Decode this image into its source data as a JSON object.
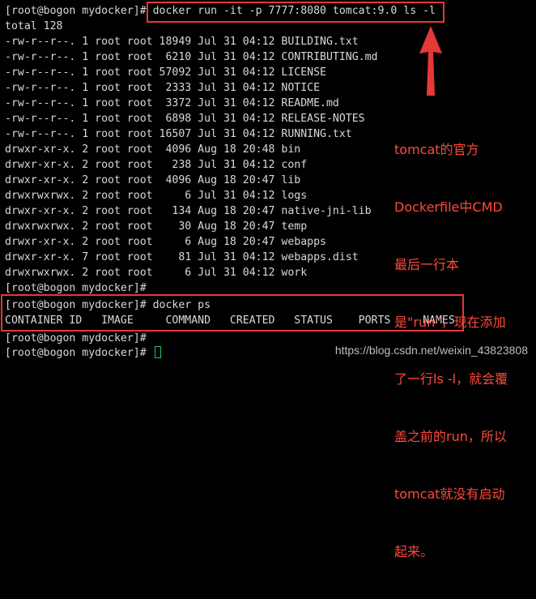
{
  "terminal": {
    "lines": [
      "[root@bogon mydocker]# docker run -it -p 7777:8080 tomcat:9.0 ls -l",
      "total 128",
      "-rw-r--r--. 1 root root 18949 Jul 31 04:12 BUILDING.txt",
      "-rw-r--r--. 1 root root  6210 Jul 31 04:12 CONTRIBUTING.md",
      "-rw-r--r--. 1 root root 57092 Jul 31 04:12 LICENSE",
      "-rw-r--r--. 1 root root  2333 Jul 31 04:12 NOTICE",
      "-rw-r--r--. 1 root root  3372 Jul 31 04:12 README.md",
      "-rw-r--r--. 1 root root  6898 Jul 31 04:12 RELEASE-NOTES",
      "-rw-r--r--. 1 root root 16507 Jul 31 04:12 RUNNING.txt",
      "drwxr-xr-x. 2 root root  4096 Aug 18 20:48 bin",
      "drwxr-xr-x. 2 root root   238 Jul 31 04:12 conf",
      "drwxr-xr-x. 2 root root  4096 Aug 18 20:47 lib",
      "drwxrwxrwx. 2 root root     6 Jul 31 04:12 logs",
      "drwxr-xr-x. 2 root root   134 Aug 18 20:47 native-jni-lib",
      "drwxrwxrwx. 2 root root    30 Aug 18 20:47 temp",
      "drwxr-xr-x. 2 root root     6 Aug 18 20:47 webapps",
      "drwxr-xr-x. 7 root root    81 Jul 31 04:12 webapps.dist",
      "drwxrwxrwx. 2 root root     6 Jul 31 04:12 work",
      "[root@bogon mydocker]#",
      "[root@bogon mydocker]# docker ps",
      "CONTAINER ID   IMAGE     COMMAND   CREATED   STATUS    PORTS     NAMES",
      "[root@bogon mydocker]#",
      "[root@bogon mydocker]# "
    ]
  },
  "annotation": {
    "lines": [
      "tomcat的官方",
      "Dockerfile中CMD",
      "最后一行本",
      "是\"run\"，现在添加",
      "了一行ls -l，就会覆",
      "盖之前的run，所以",
      "tomcat就没有启动",
      "起来。"
    ]
  },
  "watermark": "https://blog.csdn.net/weixin_43823808",
  "colors": {
    "background": "#000000",
    "text": "#d9d9d9",
    "highlight": "#e53935",
    "annotation": "#ff4a3d",
    "cursor": "#22c55e"
  }
}
